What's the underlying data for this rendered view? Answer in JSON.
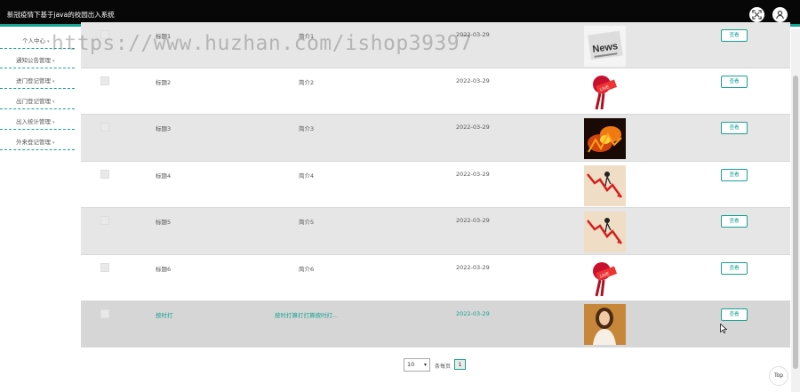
{
  "header": {
    "title": "新冠疫情下基于java的校园出入系统",
    "icons": [
      "fullscreen-icon",
      "user-icon"
    ],
    "accent": "#17a391"
  },
  "sidebar": {
    "items": [
      {
        "label": "个人中心"
      },
      {
        "label": "通知公告管理"
      },
      {
        "label": "进门登记管理"
      },
      {
        "label": "出门登记管理"
      },
      {
        "label": "出入统计管理"
      },
      {
        "label": "外来登记管理"
      }
    ]
  },
  "watermark": "https://www.huzhan.com/ishop39397",
  "table": {
    "view_label": "查看",
    "rows": [
      {
        "title": "标题1",
        "intro": "简介1",
        "date": "2022-03-29",
        "image": "news-newspaper"
      },
      {
        "title": "标题2",
        "intro": "简介2",
        "date": "2022-03-29",
        "image": "live-microphone"
      },
      {
        "title": "标题3",
        "intro": "简介3",
        "date": "2022-03-29",
        "image": "fiery-text"
      },
      {
        "title": "标题4",
        "intro": "简介4",
        "date": "2022-03-29",
        "image": "falling-chart"
      },
      {
        "title": "标题5",
        "intro": "简介5",
        "date": "2022-03-29",
        "image": "falling-chart"
      },
      {
        "title": "标题6",
        "intro": "简介6",
        "date": "2022-03-29",
        "image": "live-microphone"
      },
      {
        "title": "按时打",
        "intro": "按时打算打打算按时打...",
        "date": "2022-03-29",
        "image": "portrait-woman"
      }
    ]
  },
  "pagination": {
    "page_size": "10",
    "note": "条每页",
    "current_page": "1"
  },
  "back_to_top": "Top"
}
